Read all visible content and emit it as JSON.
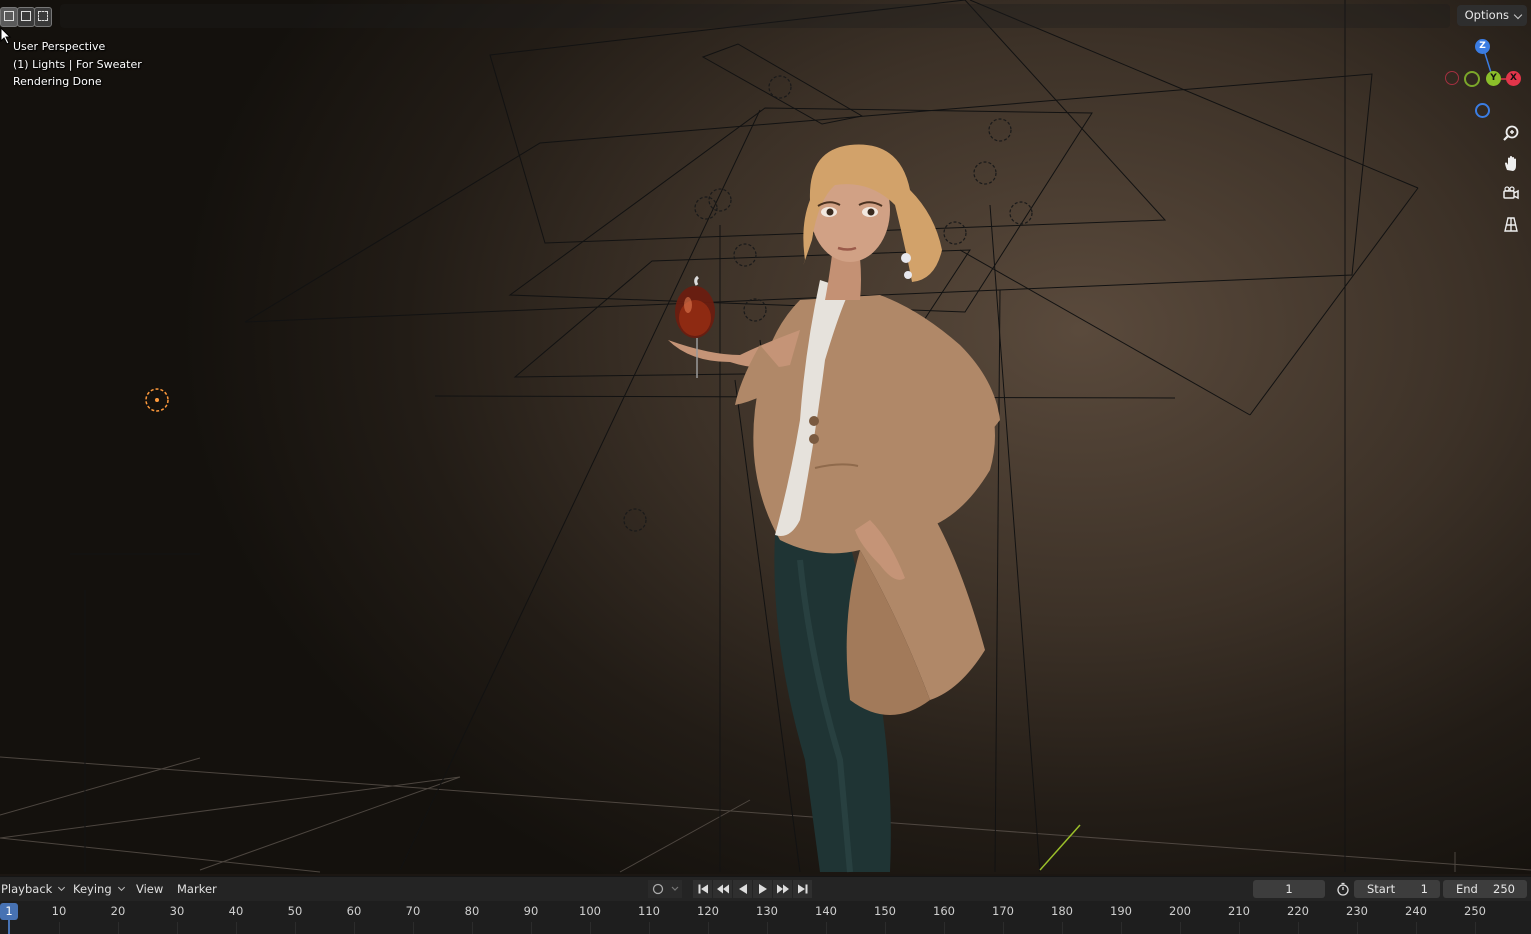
{
  "viewport": {
    "overlay": {
      "view_name": "User Perspective",
      "collection": "(1) Lights | For Sweater",
      "status": "Rendering Done"
    },
    "options_label": "Options",
    "gizmo": {
      "z_label": "Z",
      "y_label": "Y",
      "x_label": "X"
    },
    "nav_icons": [
      "zoom-icon",
      "hand-pan-icon",
      "camera-icon",
      "grid-ortho-icon"
    ]
  },
  "timeline": {
    "menus": {
      "playback": "Playback",
      "keying": "Keying",
      "view": "View",
      "marker": "Marker"
    },
    "current_frame": "1",
    "start_label": "Start",
    "start_value": "1",
    "end_label": "End",
    "end_value": "250",
    "ruler_ticks": [
      "1",
      "10",
      "20",
      "30",
      "40",
      "50",
      "60",
      "70",
      "80",
      "90",
      "100",
      "110",
      "120",
      "130",
      "140",
      "150",
      "160",
      "170",
      "180",
      "190",
      "200",
      "210",
      "220",
      "230",
      "240",
      "250"
    ],
    "playhead_frame": "1"
  },
  "colors": {
    "accent": "#4772b3",
    "light_orange": "#ff9a3c"
  }
}
